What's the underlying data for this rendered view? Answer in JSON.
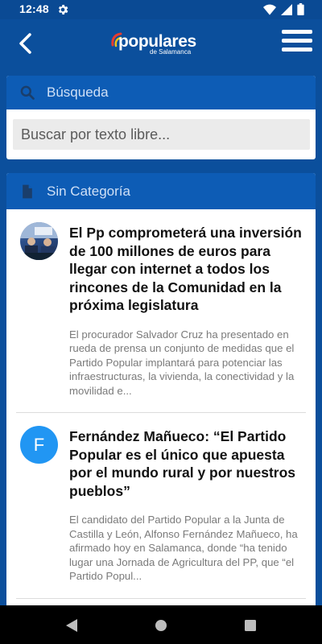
{
  "status_bar": {
    "time": "12:48",
    "icons": [
      "gear-icon",
      "wifi-icon",
      "signal-icon",
      "battery-icon"
    ]
  },
  "app_bar": {
    "logo_word": "populares",
    "logo_sub": "de Salamanca",
    "icons": [
      "back-arrow-icon",
      "hamburger-menu-icon"
    ]
  },
  "search_card": {
    "title": "Búsqueda",
    "icon": "search-icon",
    "placeholder": "Buscar por texto libre..."
  },
  "category_card": {
    "title": "Sin Categoría",
    "icon": "document-icon",
    "articles": [
      {
        "title": "El Pp comprometerá una inversión de 100 millones de euros para llegar con internet a todos los rincones de la Comunidad en la próxima legislatura",
        "excerpt": "El procurador Salvador Cruz ha presentado en rueda de prensa un conjunto de medidas que el Partido Popular implantará para potenciar las infraestructuras, la vivienda, la conectividad y la movilidad e...",
        "avatar": "photo"
      },
      {
        "title": "Fernández Mañueco: “El Partido Popular es el único que apuesta por el mundo rural y por nuestros pueblos”",
        "excerpt": "El candidato del Partido Popular a la Junta de Castilla y León, Alfonso Fernández Mañueco, ha afirmado hoy en Salamanca, donde “ha tenido lugar una Jornada de Agricultura del PP, que “el Partido Popul...",
        "avatar_letter": "F"
      }
    ]
  },
  "nav_bar": {
    "icons": [
      "nav-back-icon",
      "nav-home-icon",
      "nav-recents-icon"
    ]
  },
  "colors": {
    "primary": "#0b4f9c",
    "header": "#0d5cb5",
    "avatar_blue": "#2196f3"
  }
}
